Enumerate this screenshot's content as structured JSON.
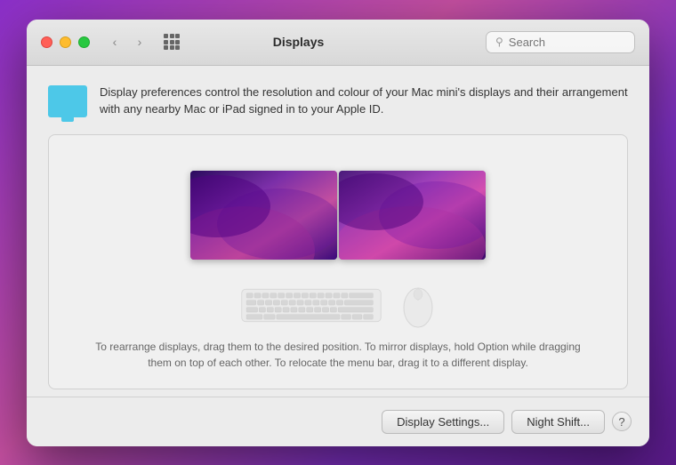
{
  "window": {
    "title": "Displays",
    "traffic_lights": {
      "close": "close",
      "minimize": "minimize",
      "maximize": "maximize"
    }
  },
  "search": {
    "placeholder": "Search"
  },
  "info": {
    "description": "Display preferences control the resolution and colour of your Mac mini's displays and their arrangement with any nearby Mac or iPad signed in to your Apple ID."
  },
  "arrangement": {
    "text": "To rearrange displays, drag them to the desired position. To mirror displays, hold Option while dragging them on top of each other. To relocate the menu bar, drag it to a different display."
  },
  "buttons": {
    "display_settings": "Display Settings...",
    "night_shift": "Night Shift...",
    "help": "?"
  }
}
